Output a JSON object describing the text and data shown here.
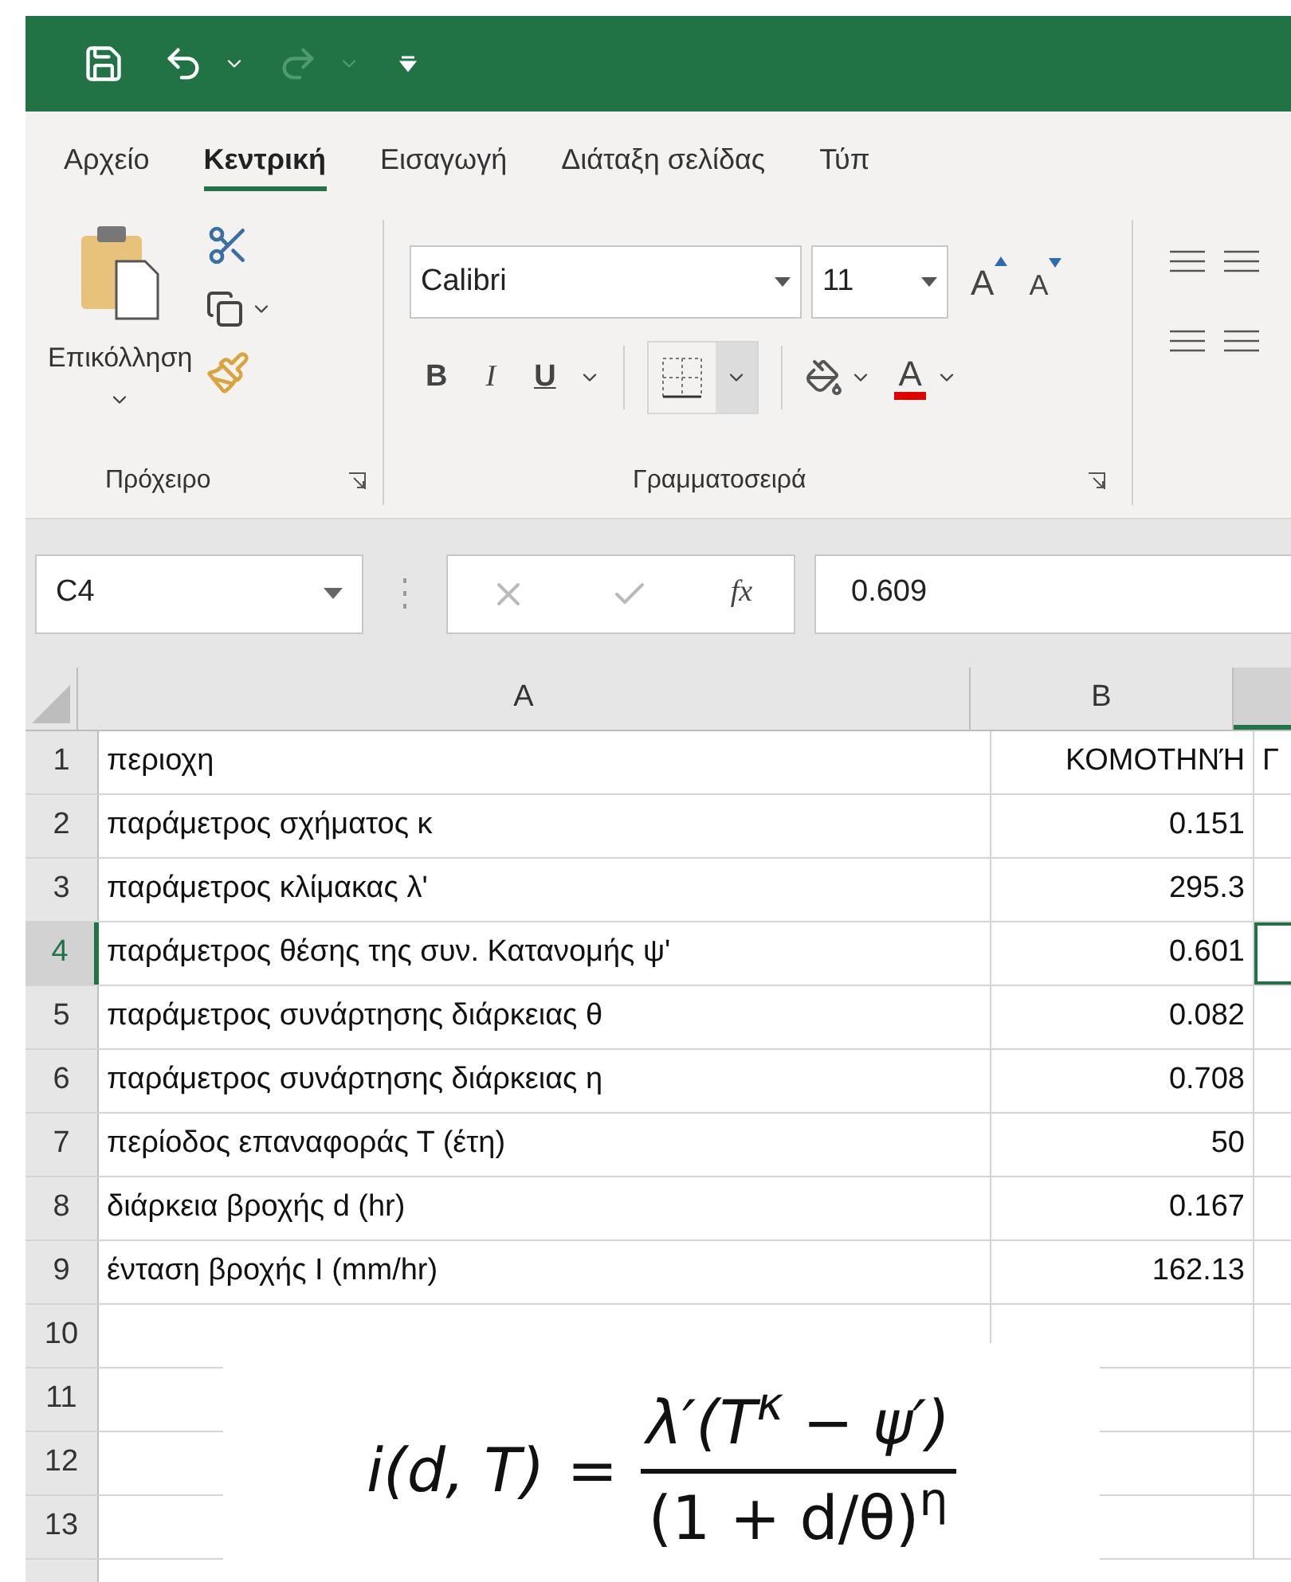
{
  "quick_access": {
    "redo_disabled": true
  },
  "tabs": [
    {
      "label": "Αρχείο",
      "selected": false
    },
    {
      "label": "Κεντρική",
      "selected": true
    },
    {
      "label": "Εισαγωγή",
      "selected": false
    },
    {
      "label": "Διάταξη σελίδας",
      "selected": false
    },
    {
      "label": "Τύπ",
      "selected": false
    }
  ],
  "clipboard": {
    "paste": "Επικόλληση",
    "group_label": "Πρόχειρο"
  },
  "font": {
    "name": "Calibri",
    "size": "11",
    "grow": "A",
    "shrink": "A",
    "bold": "B",
    "italic": "I",
    "underline": "U",
    "font_color": "A",
    "group_label": "Γραμματοσειρά"
  },
  "formula_bar": {
    "name_box": "C4",
    "fx": "fx",
    "value": "0.609"
  },
  "columns": [
    {
      "label": "A",
      "selected": false
    },
    {
      "label": "B",
      "selected": false
    },
    {
      "selected": true
    }
  ],
  "rows": [
    {
      "number": "1",
      "selected": false,
      "cells": [
        {
          "text": "περιοχη",
          "selected": false
        },
        {
          "text": "ΚΟΜΟΤΗΝΉ",
          "selected": false
        },
        {
          "text": "Γ",
          "selected": false
        }
      ]
    },
    {
      "number": "2",
      "selected": false,
      "cells": [
        {
          "text": "παράμετρος σχήματος κ",
          "selected": false
        },
        {
          "text": "0.151",
          "selected": false
        }
      ]
    },
    {
      "number": "3",
      "selected": false,
      "cells": [
        {
          "text": "παράμετρος κλίμακας λ'",
          "selected": false
        },
        {
          "text": "295.3",
          "selected": false
        }
      ]
    },
    {
      "number": "4",
      "selected": true,
      "cells": [
        {
          "text": "παράμετρος θέσης της συν. Κατανομής ψ'",
          "selected": false
        },
        {
          "text": "0.601",
          "selected": false
        },
        {
          "selected": true
        }
      ]
    },
    {
      "number": "5",
      "selected": false,
      "cells": [
        {
          "text": "παράμετρος συνάρτησης διάρκειας θ",
          "selected": false
        },
        {
          "text": "0.082",
          "selected": false
        }
      ]
    },
    {
      "number": "6",
      "selected": false,
      "cells": [
        {
          "text": "παράμετρος συνάρτησης διάρκειας η",
          "selected": false
        },
        {
          "text": "0.708",
          "selected": false
        }
      ]
    },
    {
      "number": "7",
      "selected": false,
      "cells": [
        {
          "text": "περίοδος επαναφοράς Τ (έτη)",
          "selected": false
        },
        {
          "text": "50",
          "selected": false
        }
      ]
    },
    {
      "number": "8",
      "selected": false,
      "cells": [
        {
          "text": "διάρκεια βροχής d (hr)",
          "selected": false
        },
        {
          "text": "0.167",
          "selected": false
        }
      ]
    },
    {
      "number": "9",
      "selected": false,
      "cells": [
        {
          "text": "ένταση βροχής Ι (mm/hr)",
          "selected": false
        },
        {
          "text": "162.13",
          "selected": false
        }
      ]
    },
    {
      "number": "10",
      "selected": false,
      "cells": []
    },
    {
      "number": "11",
      "selected": false,
      "cells": []
    },
    {
      "number": "12",
      "selected": false,
      "cells": []
    },
    {
      "number": "13",
      "selected": false,
      "cells": []
    }
  ],
  "equation": {
    "lhs": "i(d, T)",
    "equals": "=",
    "numerator": "λ′(T$^{κ}$ − ψ′)",
    "denominator": "(1 + d/θ)$^{η}$"
  }
}
